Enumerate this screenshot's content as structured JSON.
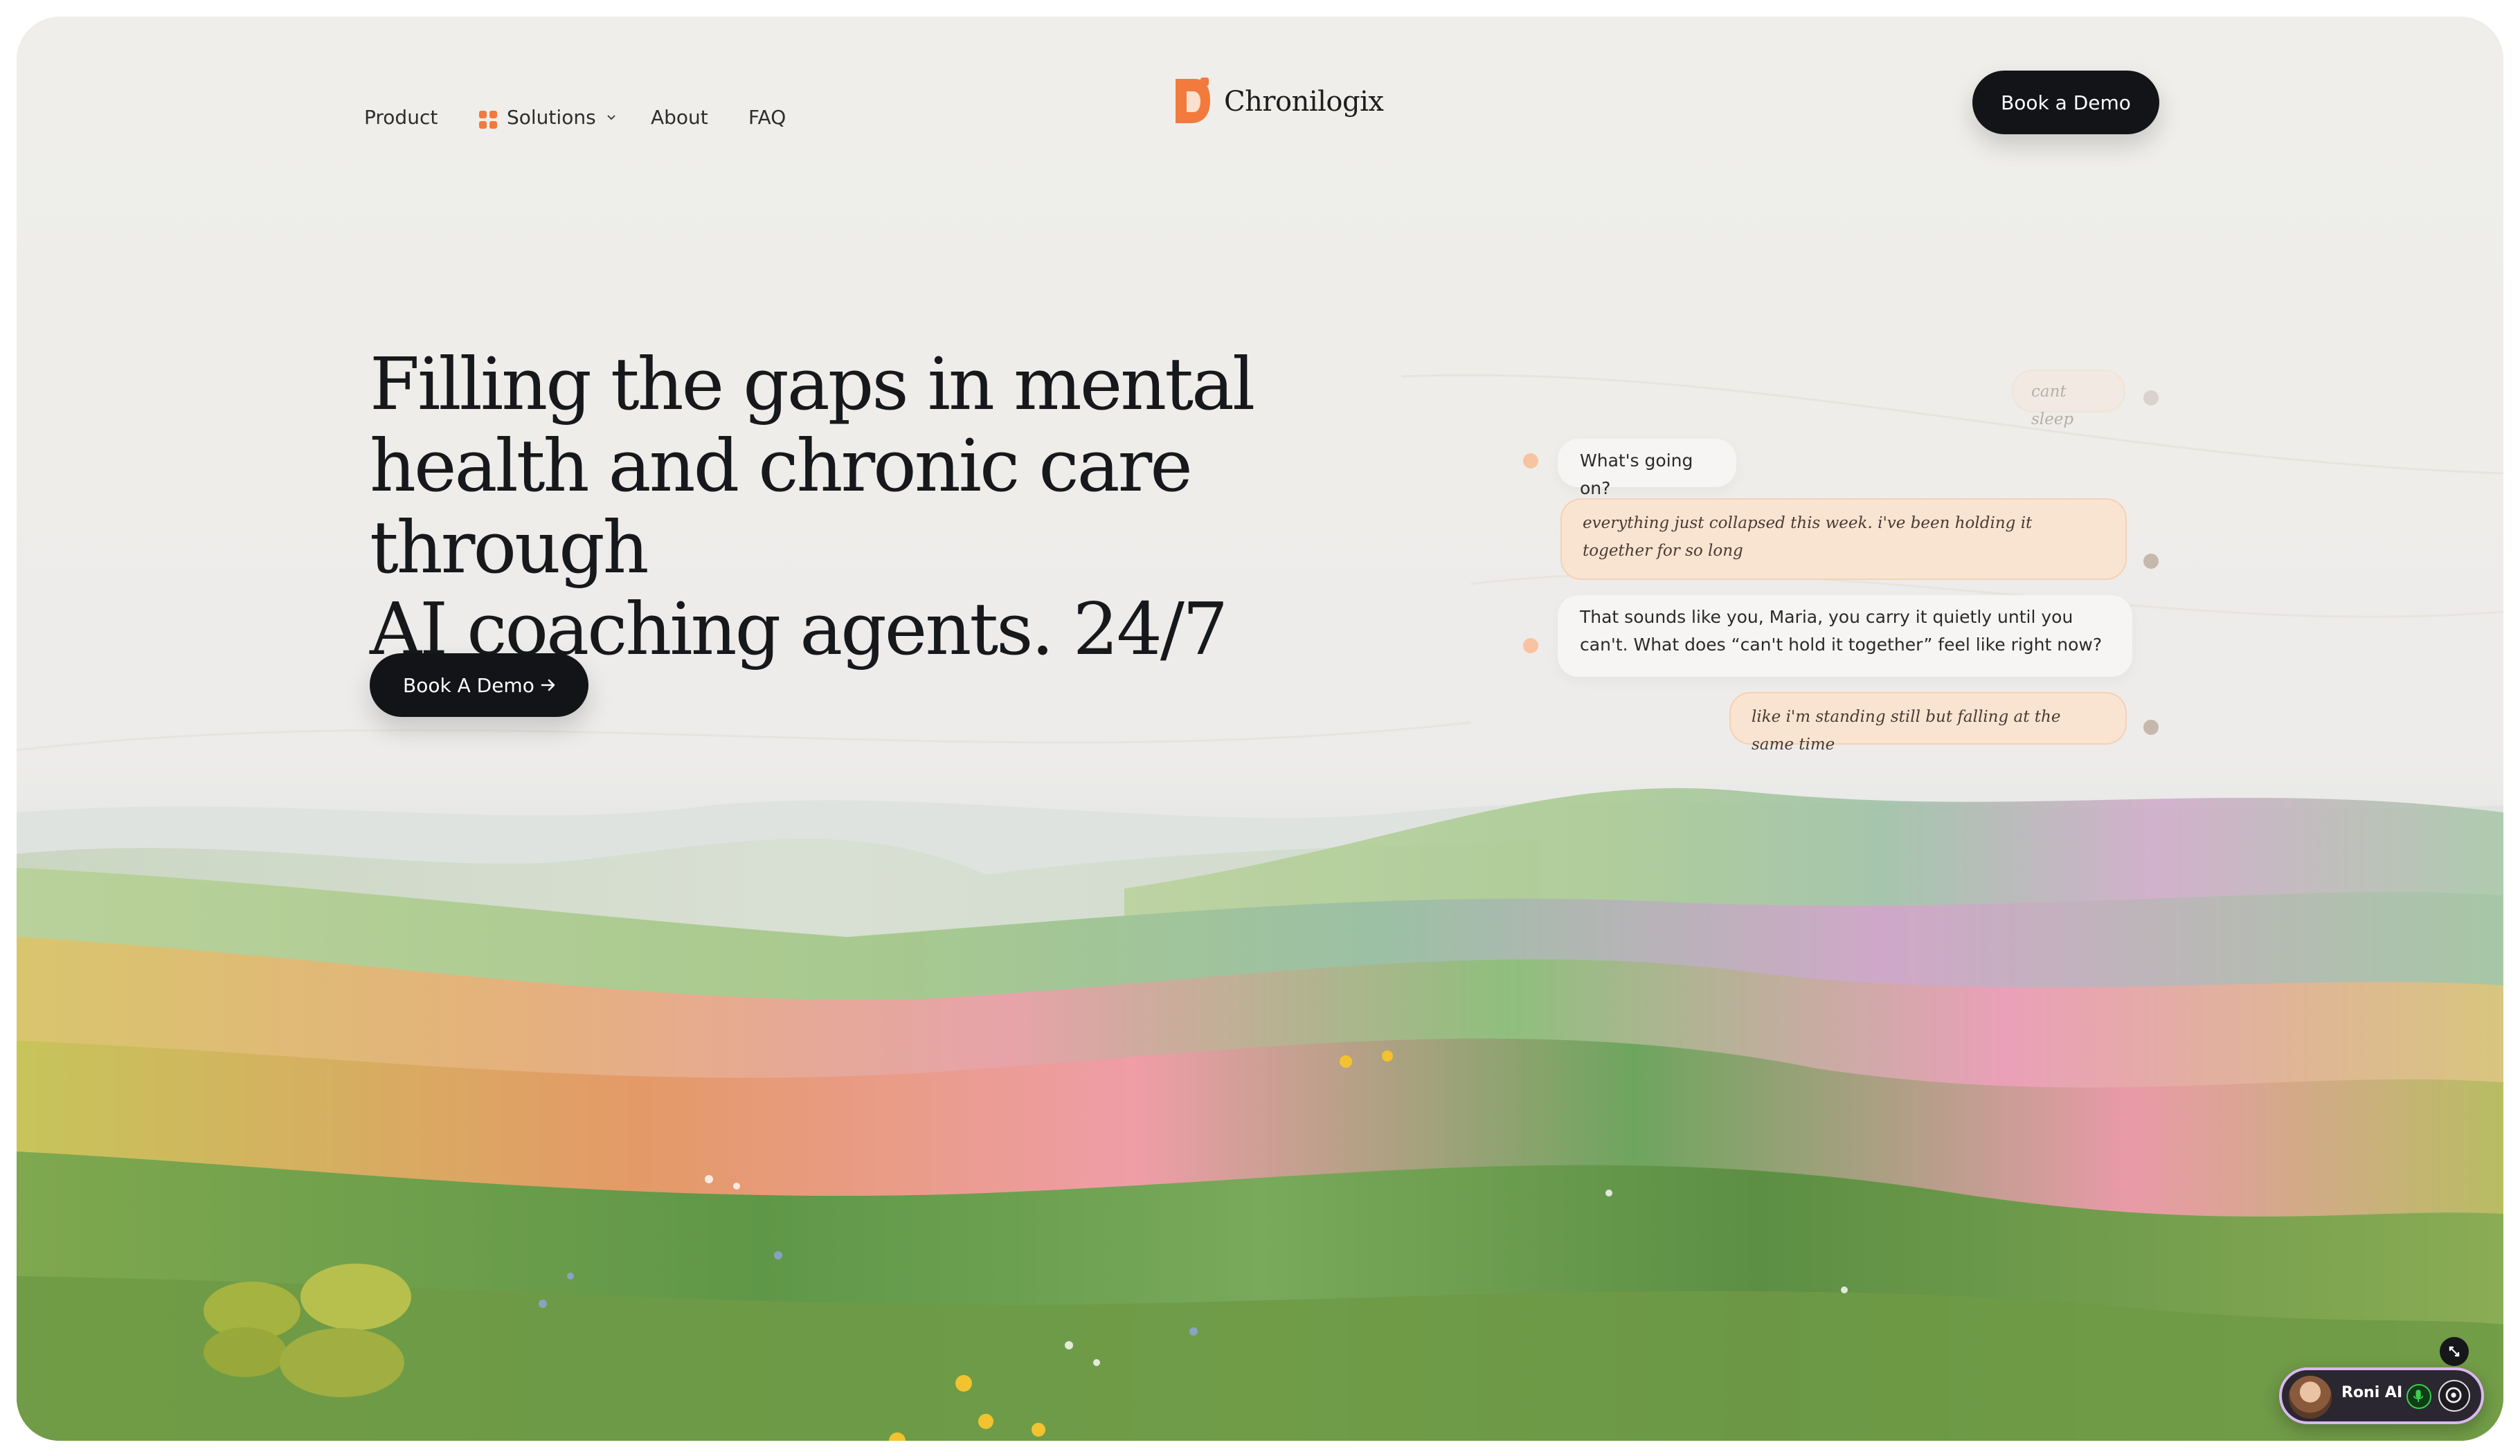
{
  "nav": {
    "links": [
      "Product",
      "Solutions",
      "About",
      "FAQ"
    ],
    "logo_text": "Chronilogix",
    "cta_label": "Book a Demo"
  },
  "hero": {
    "title_lines": [
      "Filling the gaps in mental",
      "health and chronic care through",
      "AI coaching agents. 24/7"
    ],
    "cta_label": "Book A Demo"
  },
  "chat": {
    "messages": [
      {
        "role": "user",
        "text": "cant sleep"
      },
      {
        "role": "ai",
        "text": "What's going on?"
      },
      {
        "role": "user",
        "text": "everything just collapsed this week. i've been holding it together for so long"
      },
      {
        "role": "ai",
        "text": "That sounds like you, Maria, you carry it quietly until you can't. What does “can't hold it together” feel like right now?"
      },
      {
        "role": "user",
        "text": "like i'm standing still but falling at the same time"
      }
    ]
  },
  "widget": {
    "name": "Roni AI",
    "icons": [
      "avatar",
      "microphone-icon",
      "chat-icon",
      "expand-icon"
    ]
  },
  "colors": {
    "accent": "#f27a3d",
    "button_dark": "#121417",
    "background": "#efeeeb",
    "user_bubble": "#f9e4d2"
  }
}
